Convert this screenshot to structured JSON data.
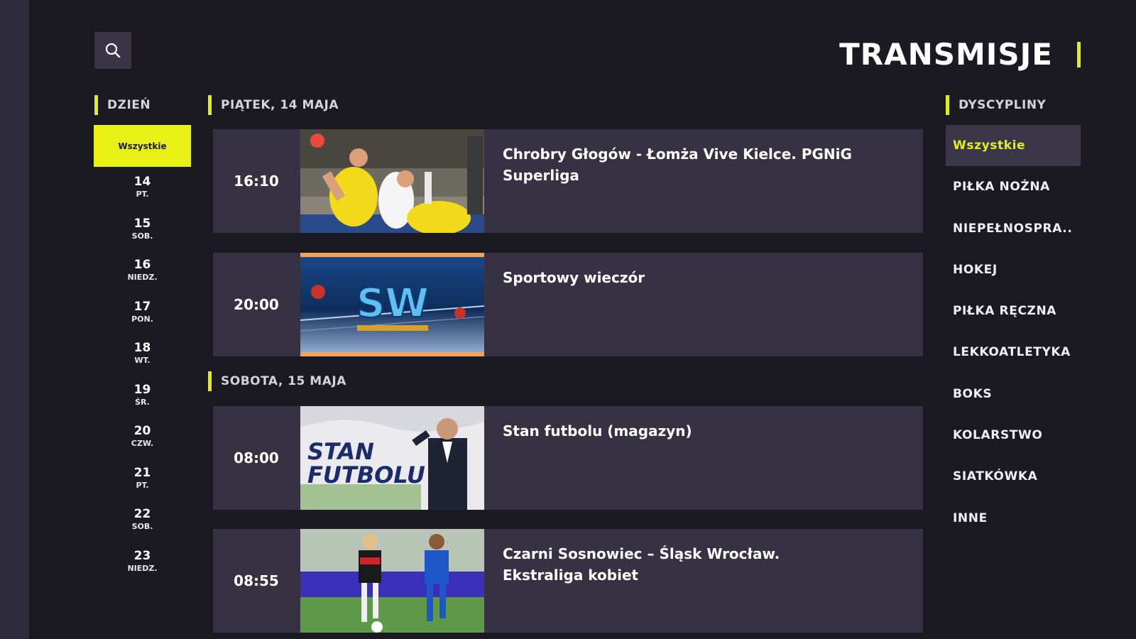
{
  "header": {
    "title": "TRANSMISJE",
    "accent_color": "#e1ec1a",
    "search_icon": "search-icon"
  },
  "days": {
    "label": "DZIEŃ",
    "all_label": "Wszystkie",
    "items": [
      {
        "num": "14",
        "abbr": "PT."
      },
      {
        "num": "15",
        "abbr": "SOB."
      },
      {
        "num": "16",
        "abbr": "NIEDZ."
      },
      {
        "num": "17",
        "abbr": "PON."
      },
      {
        "num": "18",
        "abbr": "WT."
      },
      {
        "num": "19",
        "abbr": "ŚR."
      },
      {
        "num": "20",
        "abbr": "CZW."
      },
      {
        "num": "21",
        "abbr": "PT."
      },
      {
        "num": "22",
        "abbr": "SOB."
      },
      {
        "num": "23",
        "abbr": "NIEDZ."
      }
    ]
  },
  "schedule": {
    "sections": [
      {
        "date_label": "PIĄTEK, 14 MAJA",
        "events": [
          {
            "time": "16:10",
            "title": "Chrobry Głogów - Łomża Vive Kielce. PGNiG Superliga"
          },
          {
            "time": "20:00",
            "title": "Sportowy wieczór"
          }
        ]
      },
      {
        "date_label": "SOBOTA, 15 MAJA",
        "events": [
          {
            "time": "08:00",
            "title": "Stan futbolu (magazyn)"
          },
          {
            "time": "08:55",
            "title": "Czarni Sosnowiec – Śląsk Wrocław. Ekstraliga kobiet"
          }
        ]
      }
    ]
  },
  "thumbnails": {
    "sw_logo_text": "SW",
    "stan_futbolu_text": [
      "STAN",
      "FUTBOLU"
    ]
  },
  "disciplines": {
    "label": "DYSCYPLINY",
    "items": [
      "Wszystkie",
      "PIŁKA NOŻNA",
      "NIEPEŁNOSPRA..",
      "HOKEJ",
      "PIŁKA RĘCZNA",
      "LEKKOATLETYKA",
      "BOKS",
      "KOLARSTWO",
      "SIATKÓWKA",
      "INNE"
    ],
    "active_index": 0
  }
}
